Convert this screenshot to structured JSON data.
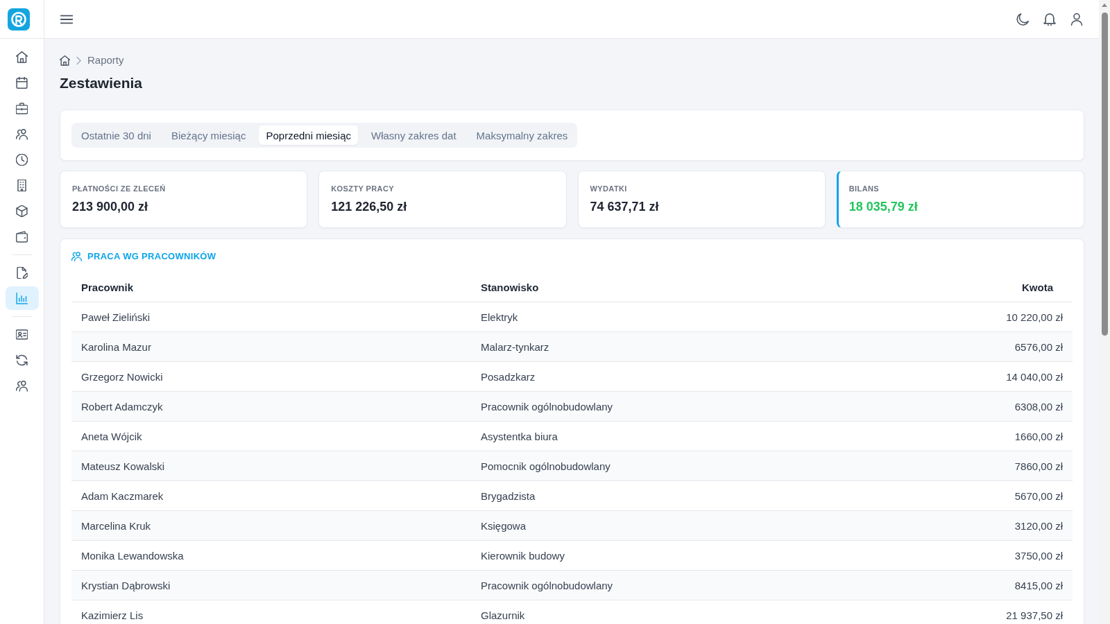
{
  "sidebar": {
    "groups": [
      {
        "items": [
          {
            "selected": false
          },
          {
            "selected": false
          },
          {
            "selected": false
          },
          {
            "selected": false
          },
          {
            "selected": false
          },
          {
            "selected": false
          },
          {
            "selected": false
          },
          {
            "selected": false
          }
        ]
      },
      {
        "items": [
          {
            "selected": false
          },
          {
            "selected": true
          }
        ]
      },
      {
        "items": [
          {
            "selected": false
          },
          {
            "selected": false
          },
          {
            "selected": false
          }
        ]
      }
    ]
  },
  "breadcrumb": [
    "Raporty"
  ],
  "page_title": "Zestawienia",
  "period_tabs": [
    {
      "label": "Ostatnie 30 dni",
      "selected": false
    },
    {
      "label": "Bieżący miesiąc",
      "selected": false
    },
    {
      "label": "Poprzedni miesiąc",
      "selected": true
    },
    {
      "label": "Własny zakres dat",
      "selected": false
    },
    {
      "label": "Maksymalny zakres",
      "selected": false
    }
  ],
  "stats": [
    {
      "label": "PŁATNOŚCI ZE ZLECEŃ",
      "value": "213 900,00 zł",
      "kind": "amount"
    },
    {
      "label": "KOSZTY PRACY",
      "value": "121 226,50 zł",
      "kind": "amount"
    },
    {
      "label": "WYDATKI",
      "value": "74 637,71 zł",
      "kind": "amount"
    },
    {
      "label": "BILANS",
      "value": "18 035,79 zł",
      "kind": "balance"
    }
  ],
  "table": {
    "title": "PRACA WG PRACOWNIKÓW",
    "columns": [
      "Pracownik",
      "Stanowisko",
      "Kwota"
    ],
    "rows": [
      [
        "Paweł Zieliński",
        "Elektryk",
        "10 220,00 zł"
      ],
      [
        "Karolina Mazur",
        "Malarz-tynkarz",
        "6576,00 zł"
      ],
      [
        "Grzegorz Nowicki",
        "Posadzkarz",
        "14 040,00 zł"
      ],
      [
        "Robert Adamczyk",
        "Pracownik ogólnobudowlany",
        "6308,00 zł"
      ],
      [
        "Aneta Wójcik",
        "Asystentka biura",
        "1660,00 zł"
      ],
      [
        "Mateusz Kowalski",
        "Pomocnik ogólnobudowlany",
        "7860,00 zł"
      ],
      [
        "Adam Kaczmarek",
        "Brygadzista",
        "5670,00 zł"
      ],
      [
        "Marcelina Kruk",
        "Księgowa",
        "3120,00 zł"
      ],
      [
        "Monika Lewandowska",
        "Kierownik budowy",
        "3750,00 zł"
      ],
      [
        "Krystian Dąbrowski",
        "Pracownik ogólnobudowlany",
        "8415,00 zł"
      ],
      [
        "Kazimierz Lis",
        "Glazurnik",
        "21 937,50 zł"
      ]
    ]
  }
}
